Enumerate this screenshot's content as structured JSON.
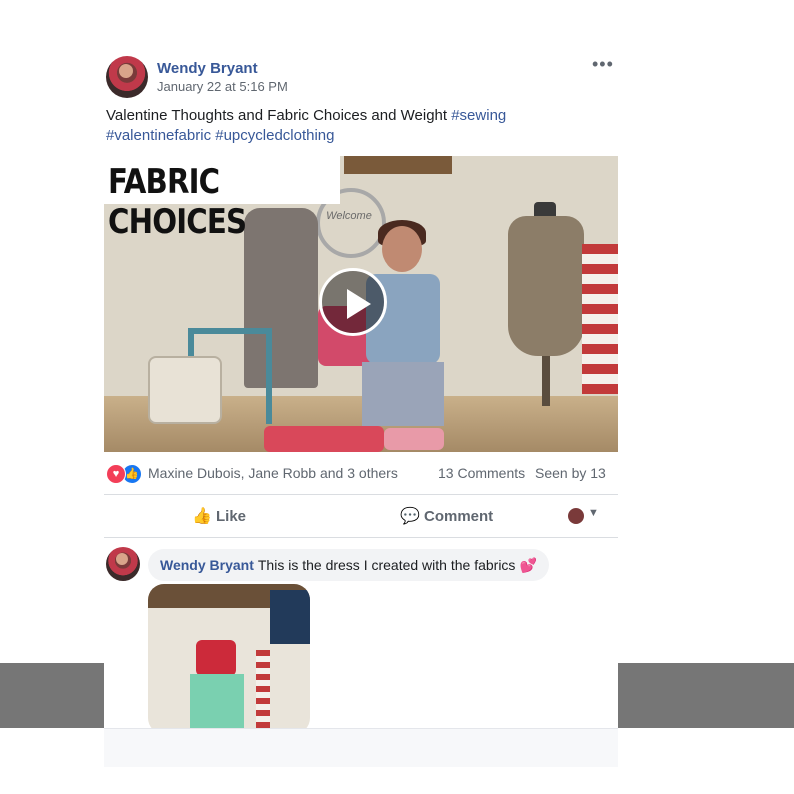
{
  "post": {
    "author": "Wendy Bryant",
    "timestamp": "January 22 at 5:16 PM",
    "more_icon": "•••",
    "text_plain": "Valentine Thoughts and Fabric Choices and Weight ",
    "hashtag1": "#sewing",
    "hashtag2": "#valentinefabric",
    "hashtag3": "#upcycledclothing"
  },
  "video": {
    "banner_text": "FABRIC CHOICES",
    "wreath_text": "Welcome"
  },
  "stats": {
    "reactors": "Maxine Dubois, Jane Robb and 3 others",
    "comments_count": "13 Comments",
    "seen_by": "Seen by 13"
  },
  "actions": {
    "like_label": "Like",
    "comment_label": "Comment",
    "caret": "▼"
  },
  "comment": {
    "author": "Wendy Bryant",
    "text": "This is the dress I created with the fabrics",
    "emoji": "💕"
  },
  "icons": {
    "love": "♥",
    "like": "👍",
    "thumb": "👍",
    "speech": "💬",
    "play": "play-icon"
  },
  "colors": {
    "link": "#385898",
    "love": "#f33e58",
    "like": "#1877f2",
    "overlay": "#767676"
  }
}
